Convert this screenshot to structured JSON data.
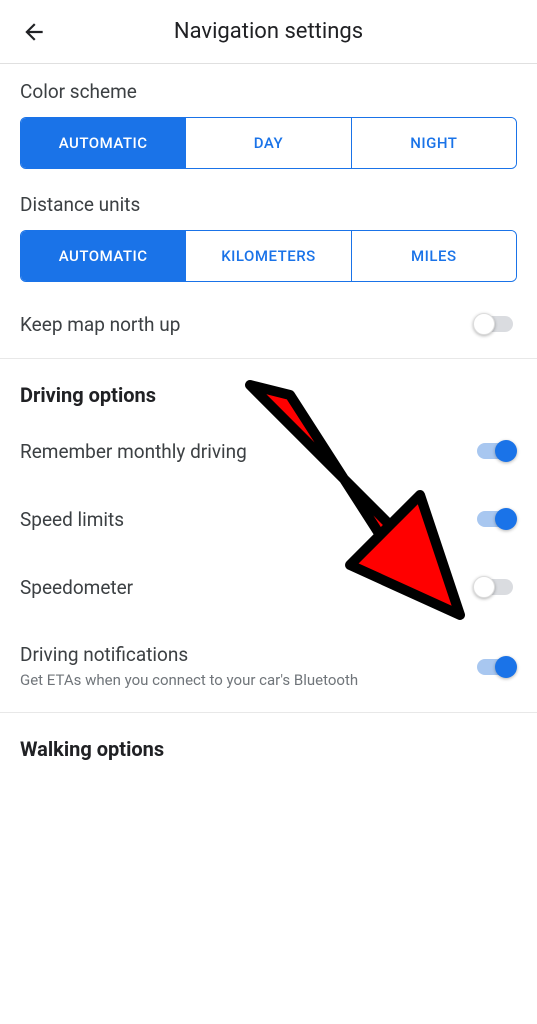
{
  "header": {
    "title": "Navigation settings"
  },
  "color_scheme": {
    "label": "Color scheme",
    "options": [
      "AUTOMATIC",
      "DAY",
      "NIGHT"
    ],
    "selected": 0
  },
  "distance_units": {
    "label": "Distance units",
    "options": [
      "AUTOMATIC",
      "KILOMETERS",
      "MILES"
    ],
    "selected": 0
  },
  "keep_north": {
    "label": "Keep map north up",
    "on": false
  },
  "driving": {
    "header": "Driving options",
    "remember": {
      "label": "Remember monthly driving",
      "on": true
    },
    "speed_limits": {
      "label": "Speed limits",
      "on": true
    },
    "speedometer": {
      "label": "Speedometer",
      "on": false
    },
    "notifications": {
      "label": "Driving notifications",
      "sub": "Get ETAs when you connect to your car's Bluetooth",
      "on": true
    }
  },
  "walking": {
    "header": "Walking options"
  }
}
